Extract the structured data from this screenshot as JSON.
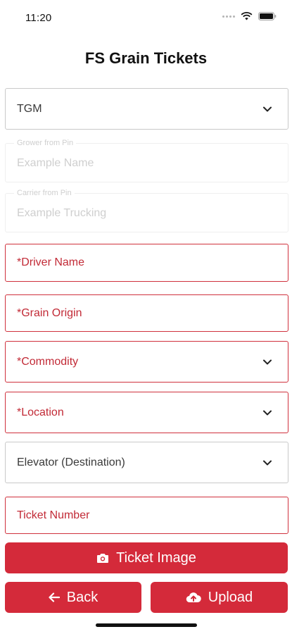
{
  "status_bar": {
    "time": "11:20"
  },
  "header": {
    "title": "FS Grain Tickets"
  },
  "form": {
    "company_select": {
      "value": "TGM"
    },
    "grower": {
      "label": "Grower from Pin",
      "placeholder": "Example Name"
    },
    "carrier": {
      "label": "Carrier from Pin",
      "placeholder": "Example Trucking"
    },
    "driver_name": {
      "placeholder": "*Driver Name"
    },
    "grain_origin": {
      "placeholder": "*Grain Origin"
    },
    "commodity": {
      "placeholder": "*Commodity"
    },
    "location": {
      "placeholder": "*Location"
    },
    "elevator": {
      "placeholder": "Elevator (Destination)"
    },
    "ticket_number": {
      "placeholder": "Ticket Number"
    }
  },
  "buttons": {
    "ticket_image": "Ticket Image",
    "back": "Back",
    "upload": "Upload"
  },
  "colors": {
    "accent": "#d42a3a",
    "error_text": "#c22a36"
  },
  "icons": [
    "wifi-icon",
    "battery-icon",
    "chevron-down-icon",
    "camera-icon",
    "arrow-left-icon",
    "cloud-upload-icon"
  ]
}
